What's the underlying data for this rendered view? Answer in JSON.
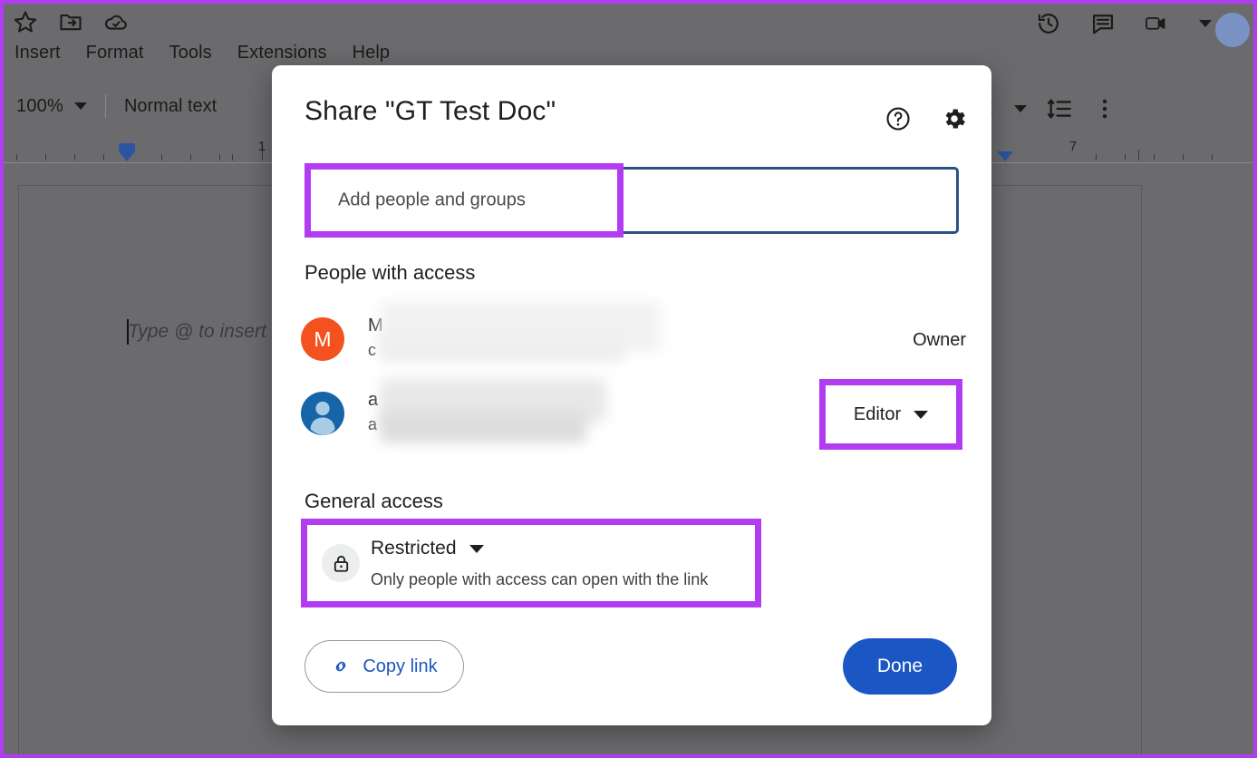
{
  "app": {
    "backdrop_dim_color": "#6b6b6e",
    "highlight_color": "#b23df0",
    "accent_blue": "#1a56c4"
  },
  "docs_toolbar": {
    "quick_icons": [
      {
        "name": "star-icon",
        "label": "Star"
      },
      {
        "name": "move-to-folder-icon",
        "label": "Move"
      },
      {
        "name": "cloud-saved-icon",
        "label": "Saved to Drive"
      }
    ],
    "menu_items": [
      "Insert",
      "Format",
      "Tools",
      "Extensions",
      "Help"
    ],
    "zoom_level": "100%",
    "paragraph_style": "Normal text",
    "right_icons": [
      {
        "name": "version-history-icon",
        "label": "Version history"
      },
      {
        "name": "comment-icon",
        "label": "Comments"
      },
      {
        "name": "meet-camera-icon",
        "label": "Join call"
      }
    ],
    "right_icons_second_row": [
      {
        "name": "align-icon",
        "label": "Alignment"
      },
      {
        "name": "line-spacing-icon",
        "label": "Line spacing"
      },
      {
        "name": "more-options-icon",
        "label": "More"
      }
    ]
  },
  "ruler": {
    "labels": [
      "1",
      "7"
    ]
  },
  "document": {
    "placeholder": "Type @ to insert"
  },
  "dialog": {
    "title": "Share \"GT Test Doc\"",
    "header_icons": [
      {
        "name": "help-icon",
        "label": "Help"
      },
      {
        "name": "settings-gear-icon",
        "label": "Settings"
      }
    ],
    "add_people": {
      "placeholder": "Add people and groups",
      "value": "",
      "highlighted": true
    },
    "people_section": {
      "heading": "People with access",
      "people": [
        {
          "avatar_initial": "M",
          "avatar_color": "#f4511e",
          "avatar_type": "initial",
          "name_visible": "M",
          "email_visible": "c",
          "redacted": true,
          "role": "Owner",
          "role_is_dropdown": false
        },
        {
          "avatar_initial": "",
          "avatar_color": "#1565a8",
          "avatar_type": "person-silhouette",
          "name_visible": "a",
          "email_visible": "a",
          "redacted": true,
          "role": "Editor",
          "role_is_dropdown": true
        }
      ]
    },
    "general_access": {
      "heading": "General access",
      "icon": "lock-icon",
      "value": "Restricted",
      "description": "Only people with access can open with the link",
      "highlighted": true
    },
    "footer": {
      "copy_link_label": "Copy link",
      "copy_link_icon": "link-icon",
      "done_label": "Done"
    }
  }
}
